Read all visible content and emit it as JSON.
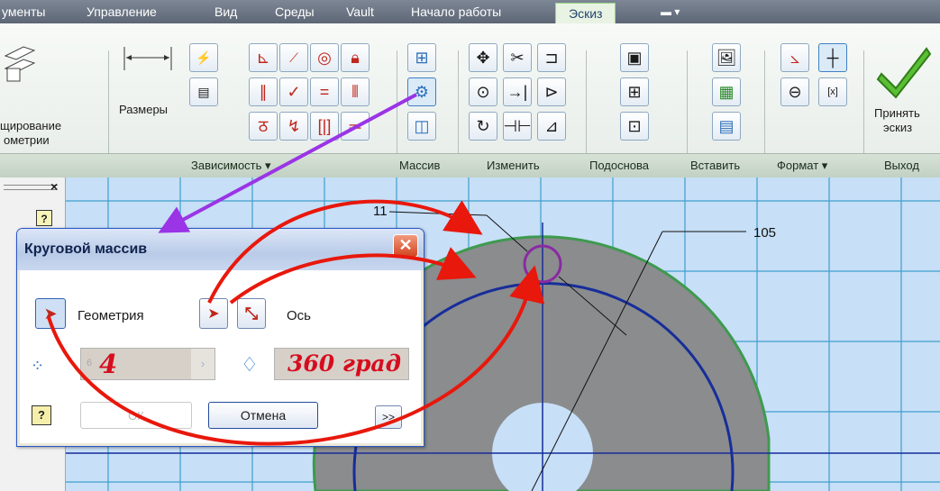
{
  "menu": {
    "tabs": [
      "ументы",
      "Управление",
      "Вид",
      "Среды",
      "Vault",
      "Начало работы",
      "Эскиз"
    ],
    "active": "Эскиз",
    "extra_icon": "camera-dropdown-icon"
  },
  "ribbon": {
    "partial_big_label_1": "щирование",
    "partial_big_label_2": "ометрии",
    "dimension_label": "Размеры",
    "accept_label_1": "Принять",
    "accept_label_2": "эскиз",
    "panels": [
      "Зависимость ▾",
      "Массив",
      "Изменить",
      "Подоснова",
      "Вставить",
      "Формат ▾",
      "Выход"
    ]
  },
  "left_panel": {
    "close": "×",
    "help": "?"
  },
  "drawing": {
    "dim_small": "11",
    "dim_large": "105"
  },
  "dialog": {
    "title": "Круговой массив",
    "geometry_label": "Геометрия",
    "axis_label": "Ось",
    "count_value": "4",
    "count_hint": "6",
    "angle_value": "360 град",
    "ok_label": "ОК",
    "cancel_label": "Отмена",
    "more_label": ">>",
    "help_label": "?"
  },
  "colors": {
    "arrow_red": "#e8180c",
    "arrow_purple": "#9a34e6",
    "part_gray": "#898b8d",
    "grid": "#3f9fcc"
  }
}
